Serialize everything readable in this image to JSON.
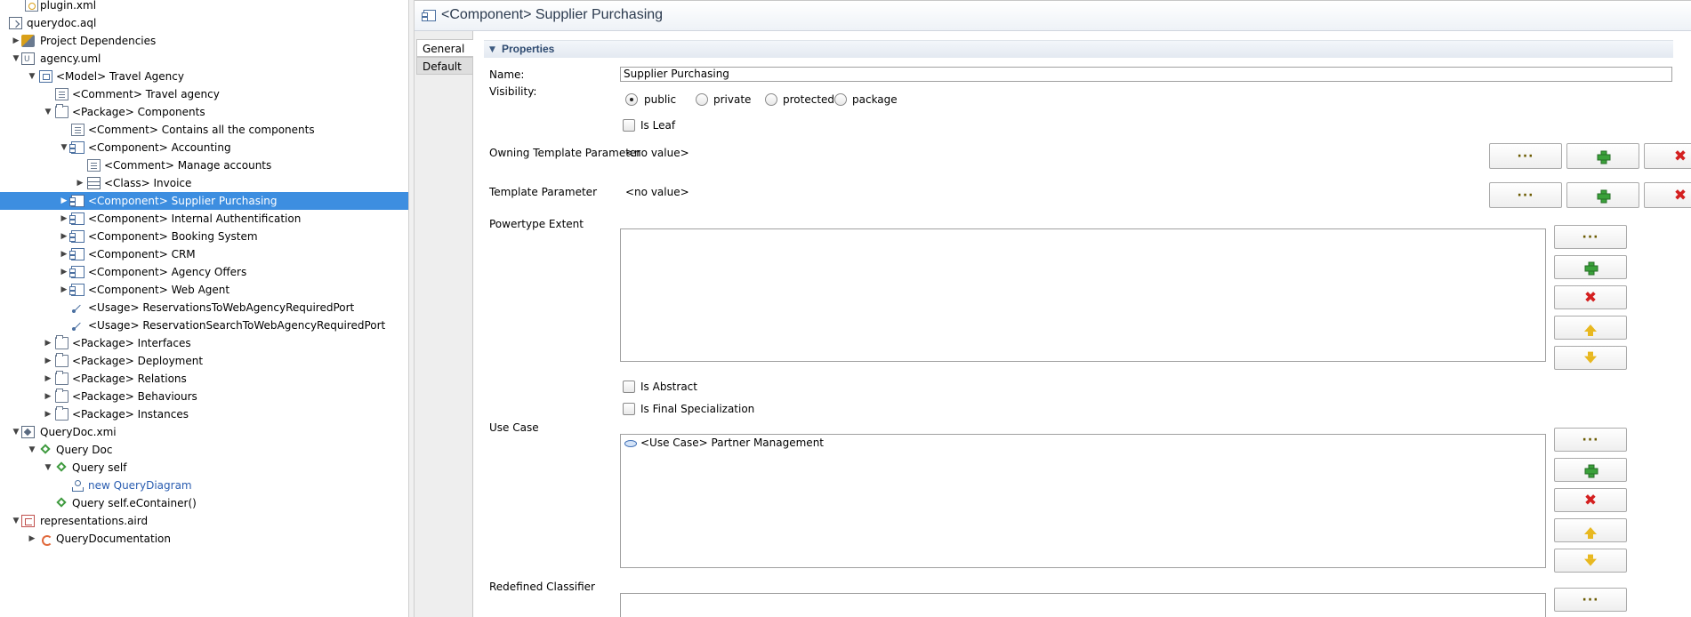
{
  "tree": {
    "rows": [
      {
        "label": "plugin.xml",
        "icon": "xml-file-icon",
        "link": false
      },
      {
        "label": "querydoc.aql",
        "icon": "aql-file-icon",
        "link": false
      },
      {
        "label": "Project Dependencies",
        "icon": "project-dependencies-icon",
        "link": false
      },
      {
        "label": "agency.uml",
        "icon": "uml-file-icon",
        "link": false
      },
      {
        "label": "<Model> Travel Agency",
        "icon": "model-icon",
        "link": false
      },
      {
        "label": "<Comment> Travel agency",
        "icon": "comment-icon",
        "link": false
      },
      {
        "label": "<Package> Components",
        "icon": "package-icon",
        "link": false
      },
      {
        "label": "<Comment> Contains all the components",
        "icon": "comment-icon",
        "link": false
      },
      {
        "label": "<Component> Accounting",
        "icon": "component-icon",
        "link": false
      },
      {
        "label": "<Comment> Manage accounts",
        "icon": "comment-icon",
        "link": false
      },
      {
        "label": "<Class> Invoice",
        "icon": "class-icon",
        "link": false
      },
      {
        "label": "<Component> Supplier Purchasing",
        "icon": "component-icon",
        "link": false
      },
      {
        "label": "<Component> Internal Authentification",
        "icon": "component-icon",
        "link": false
      },
      {
        "label": "<Component> Booking System",
        "icon": "component-icon",
        "link": false
      },
      {
        "label": "<Component> CRM",
        "icon": "component-icon",
        "link": false
      },
      {
        "label": "<Component> Agency  Offers",
        "icon": "component-icon",
        "link": false
      },
      {
        "label": "<Component> Web Agent",
        "icon": "component-icon",
        "link": false
      },
      {
        "label": "<Usage> ReservationsToWebAgencyRequiredPort",
        "icon": "usage-icon",
        "link": false
      },
      {
        "label": "<Usage> ReservationSearchToWebAgencyRequiredPort",
        "icon": "usage-icon",
        "link": false
      },
      {
        "label": "<Package> Interfaces",
        "icon": "package-icon",
        "link": false
      },
      {
        "label": "<Package> Deployment",
        "icon": "package-icon",
        "link": false
      },
      {
        "label": "<Package> Relations",
        "icon": "package-icon",
        "link": false
      },
      {
        "label": "<Package> Behaviours",
        "icon": "package-icon",
        "link": false
      },
      {
        "label": "<Package> Instances",
        "icon": "package-icon",
        "link": false
      },
      {
        "label": "QueryDoc.xmi",
        "icon": "xmi-file-icon",
        "link": false
      },
      {
        "label": "Query Doc",
        "icon": "query-icon",
        "link": false
      },
      {
        "label": "Query self",
        "icon": "query-icon",
        "link": false
      },
      {
        "label": "new QueryDiagram",
        "icon": "query-diagram-icon",
        "link": true
      },
      {
        "label": "Query self.eContainer()",
        "icon": "query-icon",
        "link": false
      },
      {
        "label": "representations.aird",
        "icon": "aird-file-icon",
        "link": false
      },
      {
        "label": "QueryDocumentation",
        "icon": "query-documentation-icon",
        "link": false
      }
    ],
    "selected_color": "#3d8ee0"
  },
  "header": {
    "title": "<Component> Supplier Purchasing",
    "icon": "component-icon"
  },
  "tabs": [
    {
      "label": "General",
      "active": true
    },
    {
      "label": "Default",
      "active": false
    }
  ],
  "properties": {
    "section_title": "Properties",
    "name_label": "Name:",
    "name_value": "Supplier Purchasing",
    "visibility_label": "Visibility:",
    "visibility_options": [
      "public",
      "private",
      "protected",
      "package"
    ],
    "visibility_selected": "public",
    "is_leaf_label": "Is Leaf",
    "owning_template_parameter_label": "Owning Template Parameter",
    "owning_template_parameter_value": "<no value>",
    "template_parameter_label": "Template Parameter",
    "template_parameter_value": "<no value>",
    "powertype_extent_label": "Powertype Extent",
    "is_abstract_label": "Is Abstract",
    "is_final_specialization_label": "Is Final Specialization",
    "use_case_label": "Use Case",
    "use_case_items": [
      "<Use Case> Partner Management"
    ],
    "redefined_classifier_label": "Redefined Classifier"
  },
  "buttons": {
    "browse_glyph": "···",
    "remove_glyph": "✖"
  }
}
